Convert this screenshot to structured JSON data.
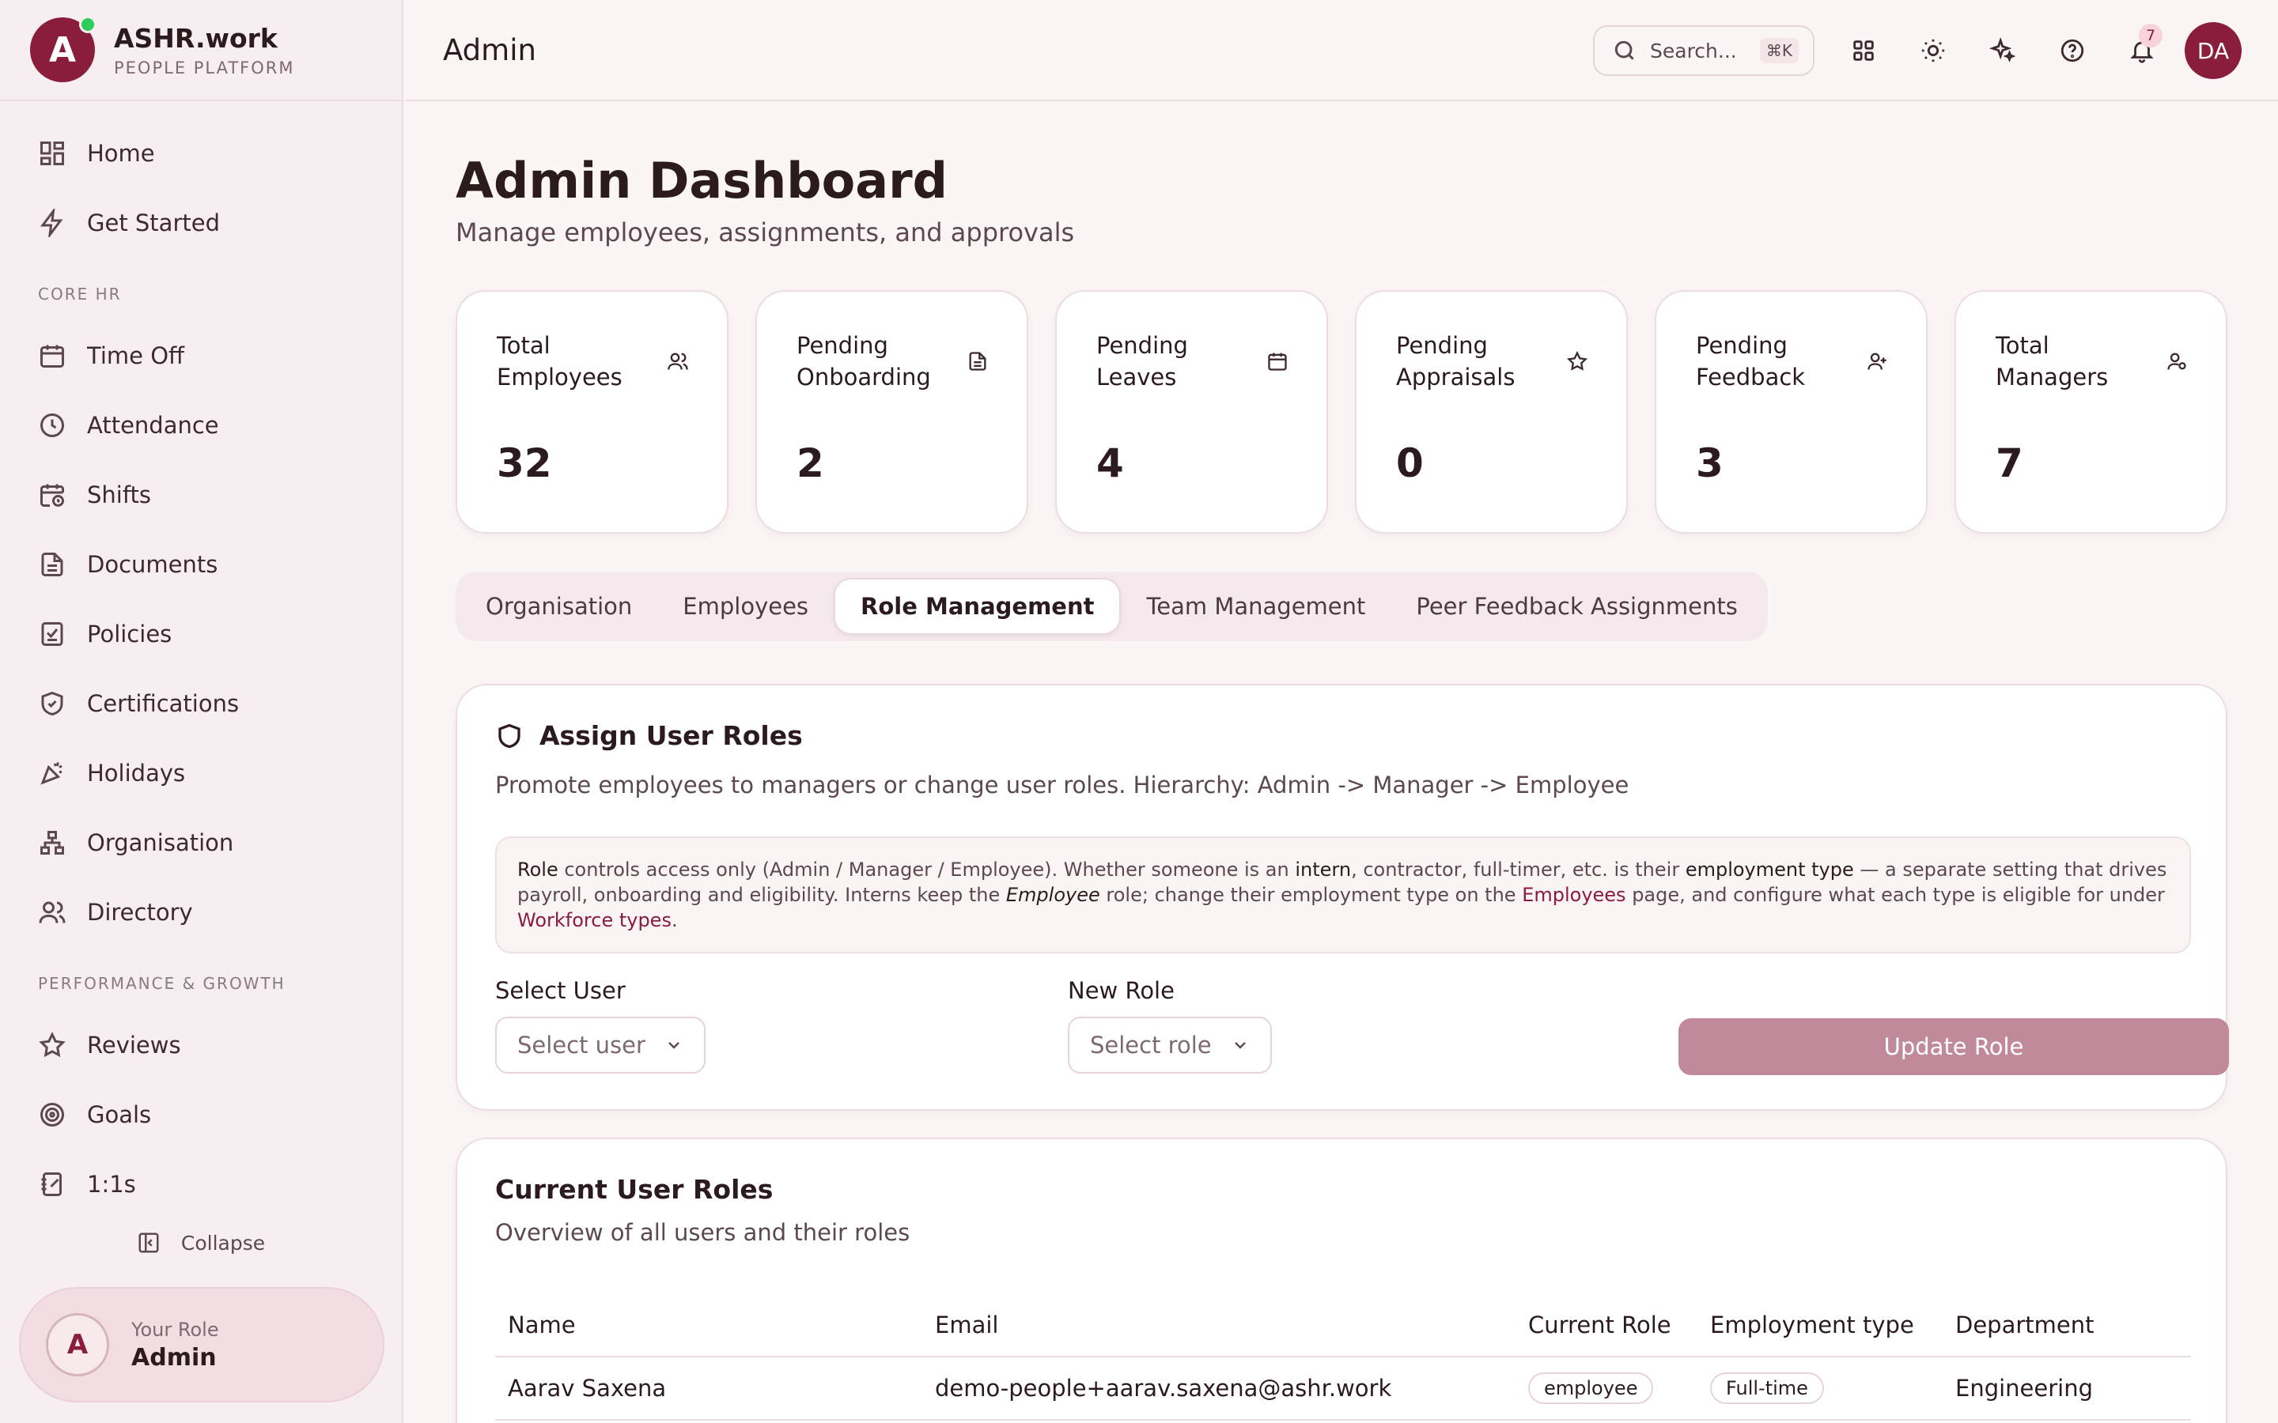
{
  "brand": {
    "name": "ASHR.work",
    "subtitle": "PEOPLE PLATFORM",
    "logo_letter": "A"
  },
  "sidebar": {
    "top_items": [
      {
        "label": "Home",
        "icon": "grid-icon"
      },
      {
        "label": "Get Started",
        "icon": "bolt-icon"
      }
    ],
    "core_label": "CORE HR",
    "core_items": [
      {
        "label": "Time Off",
        "icon": "calendar-icon"
      },
      {
        "label": "Attendance",
        "icon": "clock-icon"
      },
      {
        "label": "Shifts",
        "icon": "calendar-clock-icon"
      },
      {
        "label": "Documents",
        "icon": "document-icon"
      },
      {
        "label": "Policies",
        "icon": "checklist-icon"
      },
      {
        "label": "Certifications",
        "icon": "shield-check-icon"
      },
      {
        "label": "Holidays",
        "icon": "party-icon"
      },
      {
        "label": "Organisation",
        "icon": "org-chart-icon"
      },
      {
        "label": "Directory",
        "icon": "users-icon"
      }
    ],
    "perf_label": "PERFORMANCE & GROWTH",
    "perf_items": [
      {
        "label": "Reviews",
        "icon": "star-icon"
      },
      {
        "label": "Goals",
        "icon": "target-icon"
      },
      {
        "label": "1:1s",
        "icon": "notebook-icon"
      }
    ],
    "collapse_label": "Collapse",
    "role_card": {
      "avatar_letter": "A",
      "label": "Your Role",
      "value": "Admin"
    }
  },
  "topbar": {
    "title": "Admin",
    "search_placeholder": "Search...",
    "search_shortcut": "⌘K",
    "notification_count": "7",
    "user_initials": "DA"
  },
  "page": {
    "title": "Admin Dashboard",
    "subtitle": "Manage employees, assignments, and approvals"
  },
  "stats": [
    {
      "label": "Total Employees",
      "value": "32",
      "icon": "users-icon"
    },
    {
      "label": "Pending Onboarding",
      "value": "2",
      "icon": "document-icon"
    },
    {
      "label": "Pending Leaves",
      "value": "4",
      "icon": "calendar-icon"
    },
    {
      "label": "Pending Appraisals",
      "value": "0",
      "icon": "star-icon"
    },
    {
      "label": "Pending Feedback",
      "value": "3",
      "icon": "user-plus-icon"
    },
    {
      "label": "Total Managers",
      "value": "7",
      "icon": "user-gear-icon"
    }
  ],
  "tabs": [
    "Organisation",
    "Employees",
    "Role Management",
    "Team Management",
    "Peer Feedback Assignments"
  ],
  "active_tab": "Role Management",
  "assign_card": {
    "title": "Assign User Roles",
    "description": "Promote employees to managers or change user roles. Hierarchy: Admin -> Manager -> Employee",
    "info": {
      "t1": "Role",
      "t2": " controls access only (Admin / Manager / Employee). Whether someone is an ",
      "t3": "intern",
      "t4": ", contractor, full-timer, etc. is their ",
      "t5": "employment type",
      "t6": " — a separate setting that drives payroll, onboarding and eligibility. Interns keep the ",
      "t7": "Employee",
      "t8": " role; change their employment type on the ",
      "t9": "Employees",
      "t10": " page, and configure what each type is eligible for under ",
      "t11": "Workforce types",
      "t12": "."
    },
    "select_user_label": "Select User",
    "select_user_placeholder": "Select user",
    "new_role_label": "New Role",
    "new_role_placeholder": "Select role",
    "update_button": "Update Role"
  },
  "roles_card": {
    "title": "Current User Roles",
    "description": "Overview of all users and their roles",
    "columns": [
      "Name",
      "Email",
      "Current Role",
      "Employment type",
      "Department"
    ],
    "rows": [
      {
        "name": "Aarav Saxena",
        "email": "demo-people+aarav.saxena@ashr.work",
        "role": "employee",
        "employment": "Full-time",
        "department": "Engineering"
      }
    ]
  },
  "colors": {
    "brand": "#8a1d3c",
    "button": "#c08a9b",
    "background": "#fcf5f5"
  }
}
